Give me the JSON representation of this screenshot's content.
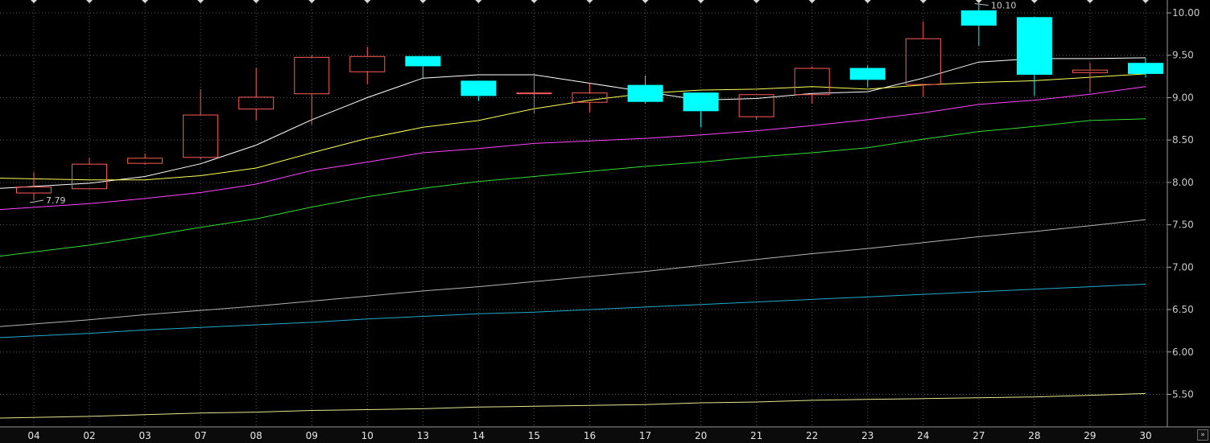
{
  "chart_data": {
    "type": "candlestick",
    "x_labels": [
      "04",
      "02",
      "03",
      "07",
      "08",
      "09",
      "10",
      "13",
      "14",
      "15",
      "16",
      "17",
      "20",
      "21",
      "22",
      "23",
      "24",
      "27",
      "28",
      "29",
      "30"
    ],
    "first_label_dim": true,
    "ylim": [
      5.2,
      10.1
    ],
    "y_ticks": [
      "10.00",
      "9.50",
      "9.00",
      "8.50",
      "8.00",
      "7.50",
      "7.00",
      "6.50",
      "6.00",
      "5.50"
    ],
    "grid": "dotted",
    "candles": [
      {
        "open": 7.88,
        "close": 7.95,
        "high": 8.12,
        "low": 7.79
      },
      {
        "open": 7.93,
        "close": 8.22,
        "high": 8.29,
        "low": 7.93
      },
      {
        "open": 8.23,
        "close": 8.29,
        "high": 8.34,
        "low": 8.21
      },
      {
        "open": 8.3,
        "close": 8.8,
        "high": 9.1,
        "low": 8.27
      },
      {
        "open": 8.87,
        "close": 9.01,
        "high": 9.35,
        "low": 8.73
      },
      {
        "open": 9.05,
        "close": 9.48,
        "high": 9.5,
        "low": 8.68
      },
      {
        "open": 9.31,
        "close": 9.49,
        "high": 9.6,
        "low": 9.16
      },
      {
        "open": 9.49,
        "close": 9.37,
        "high": 9.49,
        "low": 9.22
      },
      {
        "open": 9.2,
        "close": 9.02,
        "high": 9.2,
        "low": 8.96
      },
      {
        "open": 9.06,
        "close": 9.06,
        "high": 9.29,
        "low": 8.81
      },
      {
        "open": 8.95,
        "close": 9.06,
        "high": 9.17,
        "low": 8.83
      },
      {
        "open": 9.15,
        "close": 8.95,
        "high": 9.26,
        "low": 8.93
      },
      {
        "open": 9.06,
        "close": 8.84,
        "high": 9.06,
        "low": 8.65
      },
      {
        "open": 8.78,
        "close": 9.04,
        "high": 9.04,
        "low": 8.74
      },
      {
        "open": 9.04,
        "close": 9.35,
        "high": 9.37,
        "low": 8.93
      },
      {
        "open": 9.35,
        "close": 9.21,
        "high": 9.38,
        "low": 9.12
      },
      {
        "open": 9.16,
        "close": 9.7,
        "high": 9.9,
        "low": 9.01
      },
      {
        "open": 10.03,
        "close": 9.85,
        "high": 10.1,
        "low": 9.61
      },
      {
        "open": 9.95,
        "close": 9.27,
        "high": 9.95,
        "low": 9.02
      },
      {
        "open": 9.3,
        "close": 9.33,
        "high": 9.41,
        "low": 9.06
      },
      {
        "open": 9.41,
        "close": 9.28,
        "high": 9.47,
        "low": 9.24
      }
    ],
    "up_color": "#ff5a5a",
    "down_color": "#00ffff",
    "moving_averages": [
      {
        "color": "#ffffff",
        "values": [
          7.93,
          7.99,
          8.07,
          8.22,
          8.44,
          8.74,
          9.0,
          9.23,
          9.27,
          9.27,
          9.17,
          9.07,
          8.97,
          8.99,
          9.05,
          9.07,
          9.23,
          9.42,
          9.46,
          9.46,
          9.47
        ]
      },
      {
        "color": "#ffff55",
        "values": [
          8.05,
          8.03,
          8.03,
          8.08,
          8.17,
          8.35,
          8.52,
          8.65,
          8.73,
          8.87,
          8.97,
          9.05,
          9.09,
          9.1,
          9.13,
          9.1,
          9.15,
          9.18,
          9.2,
          9.24,
          9.28
        ]
      },
      {
        "color": "#ff44ff",
        "values": [
          7.68,
          7.75,
          7.81,
          7.88,
          7.98,
          8.14,
          8.24,
          8.35,
          8.4,
          8.46,
          8.49,
          8.52,
          8.56,
          8.61,
          8.67,
          8.74,
          8.82,
          8.92,
          8.97,
          9.04,
          9.13
        ]
      },
      {
        "color": "#33dd33",
        "values": [
          7.13,
          7.26,
          7.36,
          7.47,
          7.57,
          7.71,
          7.83,
          7.93,
          8.01,
          8.07,
          8.13,
          8.19,
          8.24,
          8.3,
          8.35,
          8.41,
          8.51,
          8.6,
          8.66,
          8.73,
          8.75
        ]
      },
      {
        "color": "#b4b4b4",
        "values": [
          6.3,
          6.38,
          6.44,
          6.49,
          6.54,
          6.6,
          6.66,
          6.72,
          6.77,
          6.83,
          6.89,
          6.95,
          7.02,
          7.09,
          7.16,
          7.22,
          7.29,
          7.36,
          7.42,
          7.49,
          7.56
        ]
      },
      {
        "color": "#22aacc",
        "values": [
          6.17,
          6.22,
          6.26,
          6.29,
          6.32,
          6.35,
          6.39,
          6.42,
          6.45,
          6.47,
          6.5,
          6.53,
          6.56,
          6.59,
          6.62,
          6.65,
          6.68,
          6.71,
          6.74,
          6.77,
          6.8
        ]
      },
      {
        "color": "#e6e68c",
        "values": [
          5.22,
          5.24,
          5.26,
          5.28,
          5.29,
          5.31,
          5.32,
          5.33,
          5.35,
          5.36,
          5.37,
          5.38,
          5.4,
          5.41,
          5.43,
          5.44,
          5.45,
          5.46,
          5.47,
          5.49,
          5.51
        ]
      }
    ],
    "annotations": [
      {
        "text": "7.79",
        "candle_index": 0
      },
      {
        "text": "10.10",
        "candle_index": 17
      }
    ]
  },
  "ui": {
    "scroll_right_symbol": "»"
  }
}
